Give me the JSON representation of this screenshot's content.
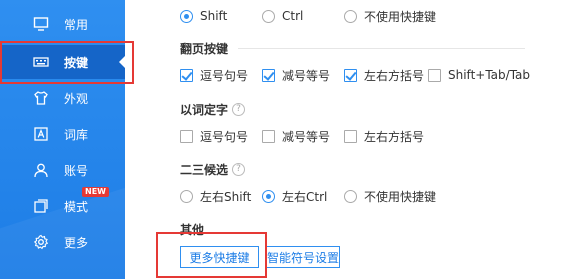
{
  "sidebar": {
    "items": [
      {
        "label": "常用",
        "icon": "monitor-icon"
      },
      {
        "label": "按键",
        "icon": "keyboard-icon",
        "active": true
      },
      {
        "label": "外观",
        "icon": "shirt-icon"
      },
      {
        "label": "词库",
        "icon": "dictionary-icon"
      },
      {
        "label": "账号",
        "icon": "user-icon"
      },
      {
        "label": "模式",
        "icon": "mode-icon",
        "badge": "NEW"
      },
      {
        "label": "更多",
        "icon": "gear-icon"
      }
    ]
  },
  "switch_row": {
    "options": [
      {
        "label": "Shift",
        "checked": true
      },
      {
        "label": "Ctrl",
        "checked": false
      },
      {
        "label": "不使用快捷键",
        "checked": false
      }
    ]
  },
  "page_turn": {
    "title": "翻页按键",
    "options": [
      {
        "label": "逗号句号",
        "checked": true
      },
      {
        "label": "减号等号",
        "checked": true
      },
      {
        "label": "左右方括号",
        "checked": true
      },
      {
        "label": "Shift+Tab/Tab",
        "checked": false
      }
    ]
  },
  "word_select": {
    "title": "以词定字",
    "help": "?",
    "options": [
      {
        "label": "逗号句号",
        "checked": false
      },
      {
        "label": "减号等号",
        "checked": false
      },
      {
        "label": "左右方括号",
        "checked": false
      }
    ]
  },
  "candidate_23": {
    "title": "二三候选",
    "help": "?",
    "options": [
      {
        "label": "左右Shift",
        "checked": false
      },
      {
        "label": "左右Ctrl",
        "checked": true
      },
      {
        "label": "不使用快捷键",
        "checked": false
      }
    ]
  },
  "other": {
    "title": "其他",
    "more_shortcuts_label": "更多快捷键",
    "smart_symbol_label": "智能符号设置"
  },
  "colors": {
    "sidebar": "#2f8ff0",
    "accent": "#2f8ff0",
    "highlight": "#e53935"
  }
}
